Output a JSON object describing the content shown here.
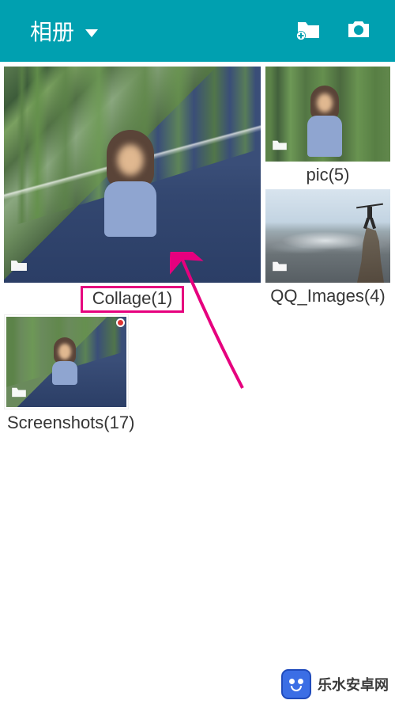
{
  "header": {
    "title": "相册",
    "newFolderIcon": "new-folder",
    "cameraIcon": "camera"
  },
  "albums": {
    "collage": {
      "label": "Collage(1)"
    },
    "pic": {
      "label": "pic(5)"
    },
    "qq": {
      "label": "QQ_Images(4)"
    },
    "screens": {
      "label": "Screenshots(17)"
    }
  },
  "watermark": {
    "text": "乐水安卓网"
  },
  "colors": {
    "accent": "#00a0b0",
    "highlight": "#e6007e"
  }
}
